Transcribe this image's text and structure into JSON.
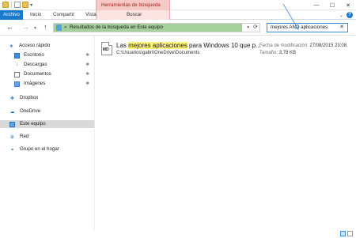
{
  "ribbon": {
    "context_title": "Herramientas de búsqueda",
    "tabs": [
      {
        "label": "Archivo"
      },
      {
        "label": "Inicio"
      },
      {
        "label": "Compartir"
      },
      {
        "label": "Vista"
      },
      {
        "label": "Buscar"
      }
    ],
    "help_label": "?"
  },
  "window_controls": {
    "minimize": "—",
    "maximize": "☐",
    "close": "✕"
  },
  "address": {
    "separator": "»",
    "path": "Resultados de la búsqueda en Este equipo"
  },
  "search": {
    "value": "mejores AND aplicaciones",
    "clear_glyph": "✕"
  },
  "sidebar": {
    "items": [
      {
        "label": "Acceso rápido",
        "icon": "star-icon"
      },
      {
        "label": "Escritorio",
        "icon": "desktop-icon",
        "pinned": true
      },
      {
        "label": "Descargas",
        "icon": "download-icon",
        "pinned": true
      },
      {
        "label": "Documentos",
        "icon": "document-icon",
        "pinned": true
      },
      {
        "label": "Imágenes",
        "icon": "pictures-icon",
        "pinned": true
      },
      {
        "label": "Dropbox",
        "icon": "dropbox-icon"
      },
      {
        "label": "OneDrive",
        "icon": "onedrive-icon"
      },
      {
        "label": "Este equipo",
        "icon": "this-pc-icon",
        "selected": true
      },
      {
        "label": "Red",
        "icon": "network-icon"
      },
      {
        "label": "Grupo en el hogar",
        "icon": "homegroup-icon"
      }
    ]
  },
  "results": {
    "items": [
      {
        "file_type": "MD",
        "title_before": "Las ",
        "title_highlight": "mejores aplicaciones",
        "title_after": " para Windows 10 que p...",
        "path": "C:\\Usuarios\\gabri\\OneDrive\\Documents",
        "modified_label": "Fecha de modificación:",
        "modified_value": "27/08/2015 23:08",
        "size_label": "Tamaño:",
        "size_value": "3,78 KB"
      }
    ]
  },
  "colors": {
    "file_tab": "#1979ca",
    "context_tab": "#f5c9c5",
    "address_highlight": "#a5cf9b",
    "search_highlight": "#fff57a",
    "selected_nav": "#d9d9d9"
  }
}
